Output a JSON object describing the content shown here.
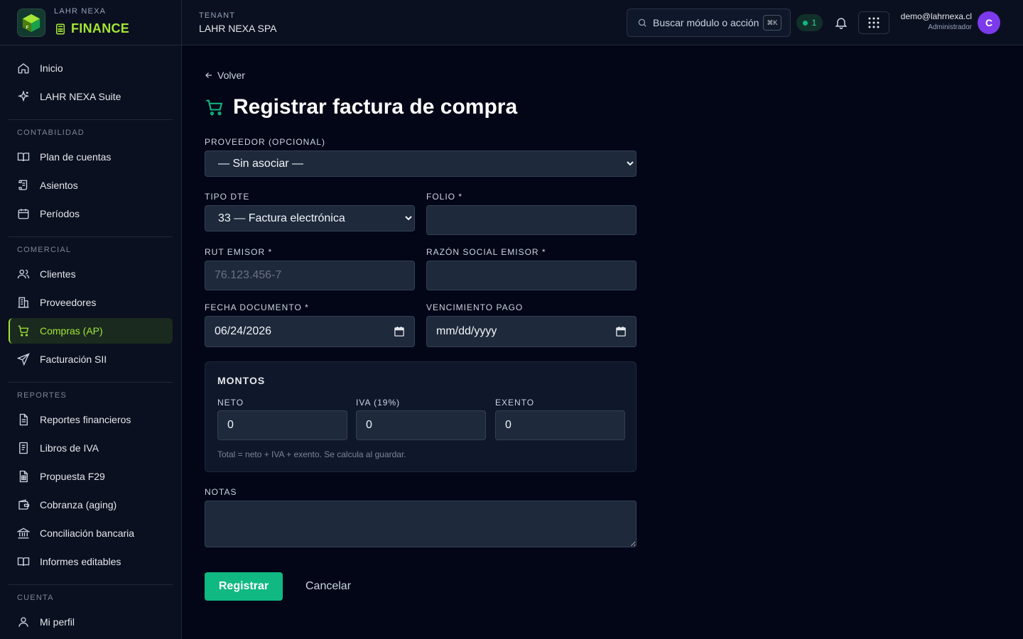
{
  "brand": {
    "small": "LAHR NEXA",
    "title": "FINANCE",
    "logo_letter": "F"
  },
  "sidebar": {
    "top_items": [
      {
        "label": "Inicio"
      },
      {
        "label": "LAHR NEXA Suite"
      }
    ],
    "sections": [
      {
        "title": "CONTABILIDAD",
        "items": [
          {
            "label": "Plan de cuentas"
          },
          {
            "label": "Asientos"
          },
          {
            "label": "Períodos"
          }
        ]
      },
      {
        "title": "COMERCIAL",
        "items": [
          {
            "label": "Clientes"
          },
          {
            "label": "Proveedores"
          },
          {
            "label": "Compras (AP)",
            "active": true
          },
          {
            "label": "Facturación SII"
          }
        ]
      },
      {
        "title": "REPORTES",
        "items": [
          {
            "label": "Reportes financieros"
          },
          {
            "label": "Libros de IVA"
          },
          {
            "label": "Propuesta F29"
          },
          {
            "label": "Cobranza (aging)"
          },
          {
            "label": "Conciliación bancaria"
          },
          {
            "label": "Informes editables"
          }
        ]
      },
      {
        "title": "CUENTA",
        "items": [
          {
            "label": "Mi perfil"
          }
        ]
      }
    ]
  },
  "topbar": {
    "tenant_label": "TENANT",
    "tenant_name": "LAHR NEXA SPA",
    "search_placeholder": "Buscar módulo o acción",
    "search_shortcut": "⌘K",
    "status_count": "1",
    "user_email": "demo@lahrnexa.cl",
    "user_role": "Administrador",
    "avatar_letter": "C"
  },
  "page": {
    "back_label": "Volver",
    "title": "Registrar factura de compra"
  },
  "form": {
    "proveedor_label": "PROVEEDOR (OPCIONAL)",
    "proveedor_value": "— Sin asociar —",
    "tipo_dte_label": "TIPO DTE",
    "tipo_dte_value": "33 — Factura electrónica",
    "folio_label": "FOLIO *",
    "folio_value": "",
    "rut_label": "RUT EMISOR *",
    "rut_placeholder": "76.123.456-7",
    "razon_label": "RAZÓN SOCIAL EMISOR *",
    "razon_value": "",
    "fecha_label": "FECHA DOCUMENTO *",
    "fecha_value": "06/24/2026",
    "venc_label": "VENCIMIENTO PAGO",
    "venc_value": "mm/dd/yyyy",
    "montos_title": "MONTOS",
    "neto_label": "NETO",
    "neto_value": "0",
    "iva_label": "IVA (19%)",
    "iva_value": "0",
    "exento_label": "EXENTO",
    "exento_value": "0",
    "hint": "Total = neto + IVA + exento. Se calcula al guardar.",
    "notas_label": "NOTAS",
    "notas_value": "",
    "submit_label": "Registrar",
    "cancel_label": "Cancelar"
  },
  "colors": {
    "accent": "#a3e635",
    "primary_button": "#10b981",
    "avatar": "#7c3aed",
    "background": "#030617"
  }
}
